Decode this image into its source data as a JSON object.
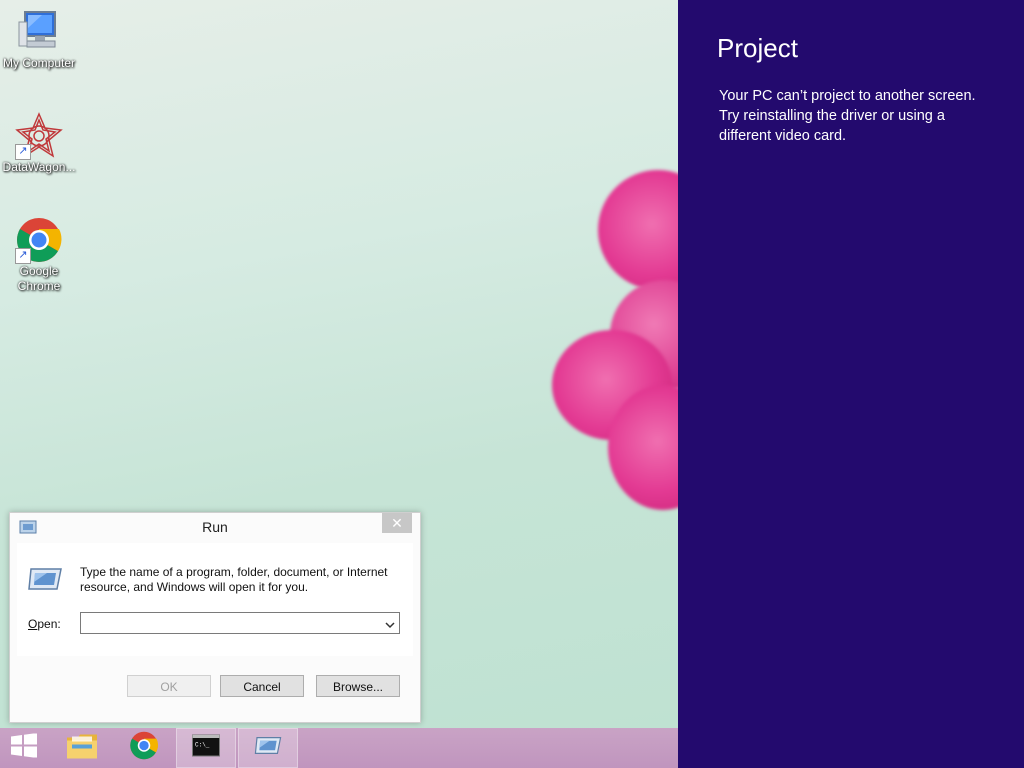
{
  "desktop": {
    "icons": [
      {
        "label": "My Computer",
        "icon": "computer-icon"
      },
      {
        "label": "DataWagon...",
        "icon": "datawagon-icon"
      },
      {
        "label": "Google Chrome",
        "icon": "chrome-icon"
      }
    ]
  },
  "project_panel": {
    "title": "Project",
    "message": "Your PC can’t project to another screen. Try reinstalling the driver or using a different video card.",
    "background": "#230a6e"
  },
  "run_dialog": {
    "title": "Run",
    "close": "✕",
    "description": "Type the name of a program, folder, document, or Internet resource, and Windows will open it for you.",
    "open_label_underlined": "O",
    "open_label_rest": "pen:",
    "open_value": "",
    "buttons": {
      "ok": "OK",
      "cancel": "Cancel",
      "browse": "Browse..."
    }
  },
  "taskbar": {
    "items": [
      {
        "icon": "windows-start-icon"
      },
      {
        "icon": "file-explorer-icon"
      },
      {
        "icon": "chrome-icon"
      },
      {
        "icon": "command-prompt-icon",
        "glyph": "C:\\_"
      },
      {
        "icon": "run-icon"
      }
    ]
  }
}
